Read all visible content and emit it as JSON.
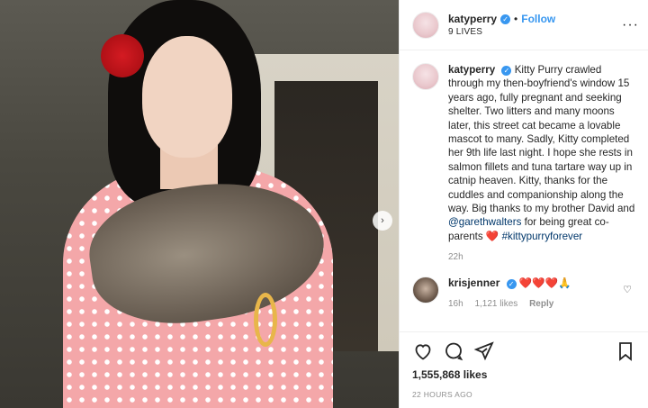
{
  "post": {
    "account": "katyperry",
    "follow_label": "Follow",
    "separator": "•",
    "subtitle": "9 LIVES",
    "more_label": "···",
    "caption": {
      "username": "katyperry",
      "part1": "Kitty Purry crawled through my then-boyfriend's window 15 years ago, fully pregnant and seeking shelter. Two litters and many moons later, this street cat became a lovable mascot to many. Sadly, Kitty completed her 9th life last night. I hope she rests in salmon fillets and tuna tartare way up in catnip heaven. Kitty, thanks for the cuddles and companionship along the way. Big thanks to my brother David and",
      "mention": "@garethwalters",
      "part2": "for being great co-parents",
      "heart": "❤️",
      "hashtag": "#kittypurryforever",
      "time": "22h"
    },
    "reply": {
      "username": "krisjenner",
      "text": "❤️❤️❤️🙏",
      "time": "16h",
      "likes": "1,121 likes",
      "reply_label": "Reply"
    },
    "likes_count": "1,555,868 likes",
    "posted_ago": "22 HOURS AGO",
    "nav_arrow": "›"
  },
  "icons": {
    "verified": "✓",
    "like_small": "♡"
  }
}
